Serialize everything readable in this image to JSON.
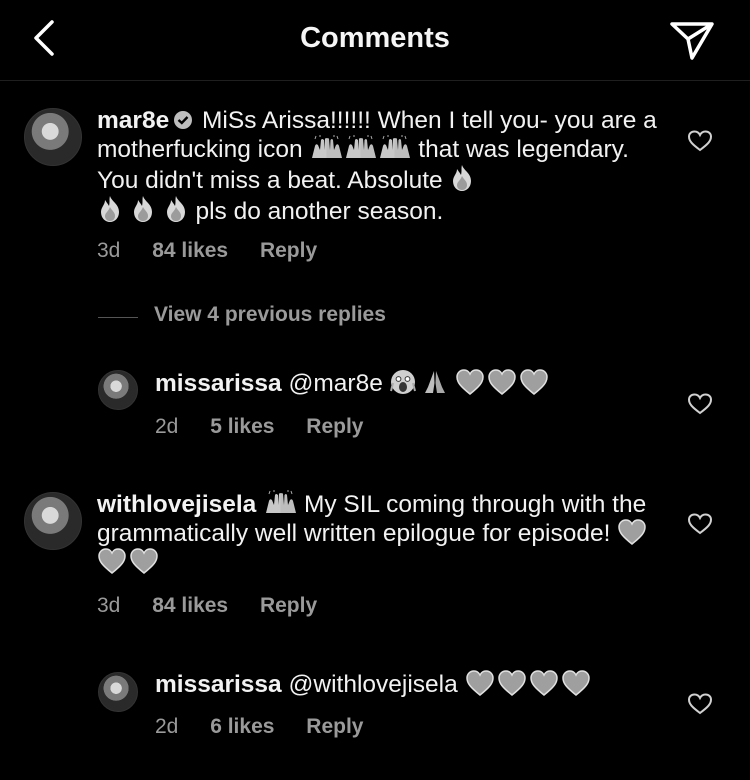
{
  "header": {
    "title": "Comments",
    "back_icon": "chevron-left-icon",
    "send_icon": "paper-plane-icon"
  },
  "comments": [
    {
      "username": "mar8e",
      "verified": true,
      "text_parts": [
        "MiSs Arissa!!!!!! When I tell you- you are a motherfucking icon",
        "that was legendary. You didn't miss a beat. Absolute",
        "pls do another season."
      ],
      "emojis": [
        "raising-hands",
        "raising-hands",
        "raising-hands",
        "fire",
        "fire",
        "fire",
        "fire"
      ],
      "time": "3d",
      "likes": "84 likes",
      "reply": "Reply"
    },
    {
      "username": "missarissa",
      "mention": "@mar8e",
      "emojis": [
        "screaming-face",
        "folded-hands",
        "grey-heart",
        "grey-heart",
        "grey-heart"
      ],
      "time": "2d",
      "likes": "5 likes",
      "reply": "Reply"
    },
    {
      "username": "withlovejisela",
      "text_parts": [
        "My SIL coming through with the grammatically well written epilogue for episode!"
      ],
      "emojis": [
        "raising-hands",
        "grey-heart",
        "grey-heart",
        "grey-heart"
      ],
      "time": "3d",
      "likes": "84 likes",
      "reply": "Reply"
    },
    {
      "username": "missarissa",
      "mention": "@withlovejisela",
      "emojis": [
        "grey-heart",
        "grey-heart",
        "grey-heart",
        "grey-heart"
      ],
      "time": "2d",
      "likes": "6 likes",
      "reply": "Reply"
    }
  ],
  "view_replies": "View 4 previous replies",
  "colors": {
    "background": "#000000",
    "text": "#f2f2f2",
    "secondary": "#9a9a9a"
  }
}
